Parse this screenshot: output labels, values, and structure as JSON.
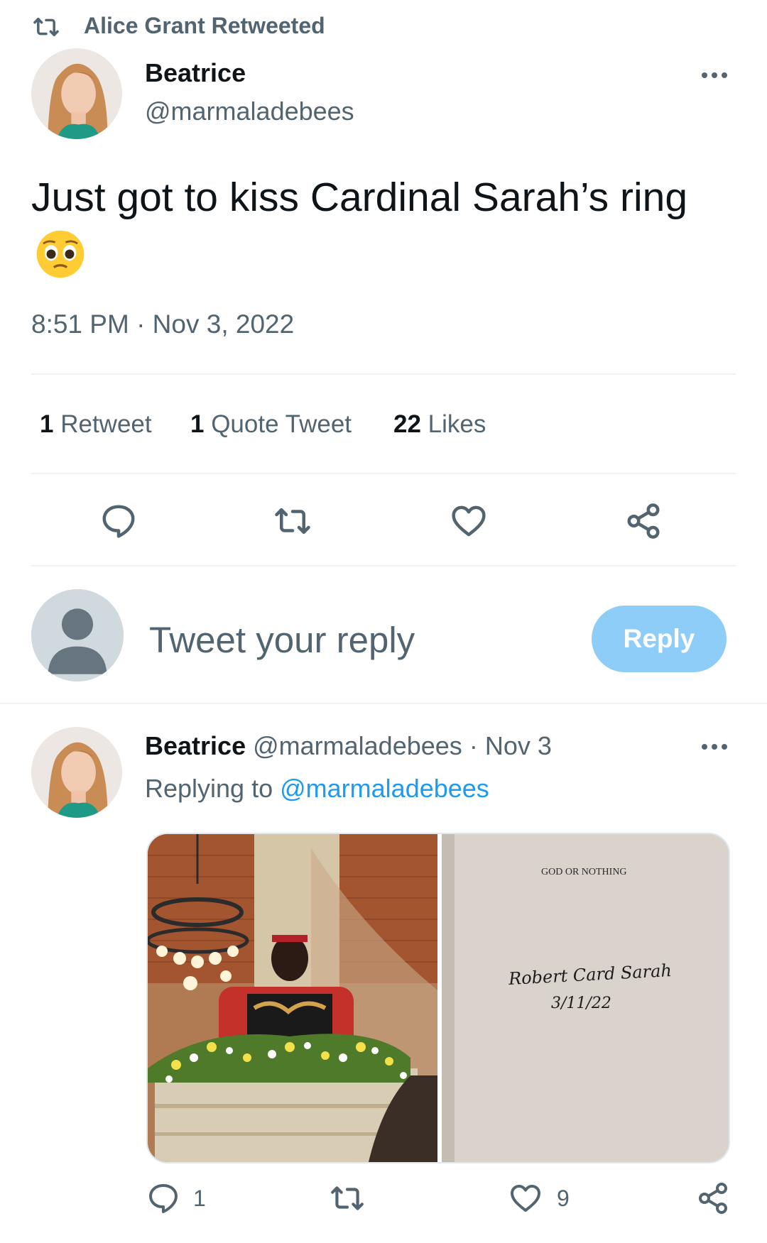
{
  "retweet_banner": {
    "text": "Alice Grant Retweeted",
    "icon": "retweet-icon"
  },
  "main_tweet": {
    "author_name": "Beatrice",
    "author_handle": "@marmaladebees",
    "text": "Just got to kiss Cardinal Sarah’s ring",
    "emoji": "pleading-face-emoji",
    "timestamp": "8:51 PM · Nov 3, 2022",
    "stats": {
      "retweets_count": "1",
      "retweets_label": "Retweet",
      "quotes_count": "1",
      "quotes_label": "Quote Tweet",
      "likes_count": "22",
      "likes_label": "Likes"
    },
    "actions": [
      "reply-icon",
      "retweet-icon",
      "like-icon",
      "share-icon"
    ]
  },
  "reply_box": {
    "placeholder": "Tweet your reply",
    "button_label": "Reply"
  },
  "reply_tweet": {
    "author_name": "Beatrice",
    "author_handle": "@marmaladebees",
    "separator": "·",
    "date": "Nov 3",
    "replying_label": "Replying to",
    "replying_handle": "@marmaladebees",
    "book_page": {
      "title": "GOD OR NOTHING",
      "signature": "Robert Card Sarah",
      "signature_date": "3/11/22"
    },
    "counts": {
      "replies": "1",
      "likes": "9"
    }
  },
  "colors": {
    "accent": "#1d9bf0",
    "muted": "#536471",
    "reply_button": "#8ecdf7"
  }
}
